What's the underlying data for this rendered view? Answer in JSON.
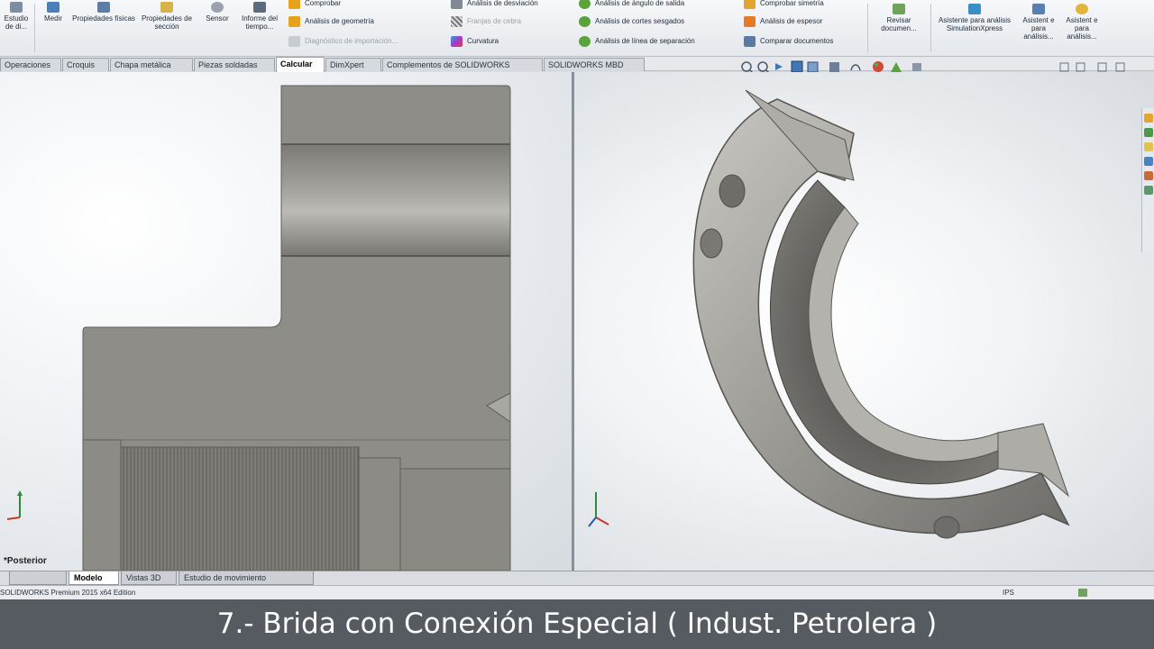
{
  "ribbon": {
    "left_buttons": [
      {
        "label": "Estudio de di...",
        "icon": "study-icon"
      },
      {
        "label": "Medir",
        "icon": "measure-icon"
      },
      {
        "label": "Propiedades físicas",
        "icon": "mass-properties-icon"
      },
      {
        "label": "Propiedades de sección",
        "icon": "section-properties-icon"
      },
      {
        "label": "Sensor",
        "icon": "sensor-icon"
      },
      {
        "label": "Informe del tiempo...",
        "icon": "performance-report-icon"
      }
    ],
    "col1": [
      {
        "label": "Comprobar",
        "icon": "check-icon",
        "enabled": true
      },
      {
        "label": "Análisis de geometría",
        "icon": "geometry-analysis-icon",
        "enabled": true
      },
      {
        "label": "Diagnóstico de importación...",
        "icon": "import-diagnostics-icon",
        "enabled": false
      }
    ],
    "col2": [
      {
        "label": "Análisis de desviación",
        "icon": "deviation-icon",
        "enabled": true
      },
      {
        "label": "Franjas de cebra",
        "icon": "zebra-stripes-icon",
        "enabled": false
      },
      {
        "label": "Curvatura",
        "icon": "curvature-icon",
        "enabled": true
      }
    ],
    "col3": [
      {
        "label": "Análisis de ángulo de salida",
        "icon": "draft-analysis-icon",
        "enabled": true
      },
      {
        "label": "Análisis de cortes sesgados",
        "icon": "undercut-icon",
        "enabled": true
      },
      {
        "label": "Análisis de línea de separación",
        "icon": "parting-line-icon",
        "enabled": true
      }
    ],
    "col4": [
      {
        "label": "Comprobar simetría",
        "icon": "symmetry-icon",
        "enabled": true
      },
      {
        "label": "Análisis de espesor",
        "icon": "thickness-icon",
        "enabled": true
      },
      {
        "label": "Comparar documentos",
        "icon": "compare-icon",
        "enabled": true
      }
    ],
    "right_buttons": [
      {
        "label": "Revisar documen...",
        "icon": "review-doc-icon"
      },
      {
        "label": "Asistente para análisis SimulationXpress",
        "icon": "simxpress-icon"
      },
      {
        "label": "Asistent e para análisis...",
        "icon": "floxpress-icon"
      },
      {
        "label": "Asistent e para análisis...",
        "icon": "dfmxpress-icon"
      }
    ]
  },
  "tabs": [
    {
      "label": "Operaciones",
      "active": false
    },
    {
      "label": "Croquis",
      "active": false
    },
    {
      "label": "Chapa metálica",
      "active": false
    },
    {
      "label": "Piezas soldadas",
      "active": false
    },
    {
      "label": "Calcular",
      "active": true
    },
    {
      "label": "DimXpert",
      "active": false
    },
    {
      "label": "Complementos de SOLIDWORKS",
      "active": false
    },
    {
      "label": "SOLIDWORKS MBD",
      "active": false
    }
  ],
  "viewports": {
    "left_view_label": "*Posterior"
  },
  "bottom_tabs": [
    {
      "label": "",
      "active": false
    },
    {
      "label": "Modelo",
      "active": true
    },
    {
      "label": "Vistas 3D",
      "active": false
    },
    {
      "label": "Estudio de movimiento",
      "active": false
    }
  ],
  "status": {
    "edition": "SOLIDWORKS Premium 2015 x64 Edition",
    "units": "IPS"
  },
  "caption": "7.- Brida con Conexión Especial ( Indust. Petrolera )",
  "colors": {
    "part_gray": "#8e8c87",
    "caption_bg": "#555b60"
  }
}
